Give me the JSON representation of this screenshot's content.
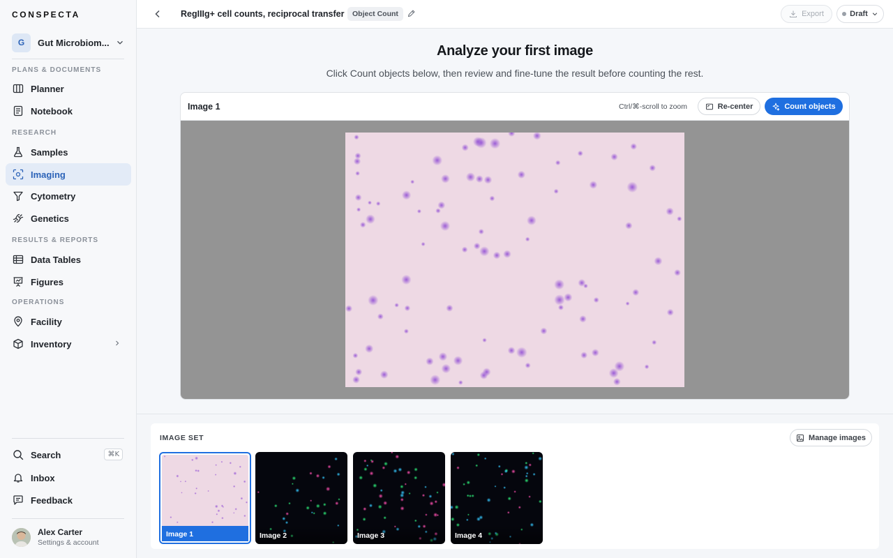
{
  "app": {
    "logo": "CONSPECTA"
  },
  "workspace": {
    "initial": "G",
    "name": "Gut Microbiom..."
  },
  "sidebar": {
    "sections": [
      {
        "label": "PLANS & DOCUMENTS",
        "items": [
          {
            "label": "Planner",
            "icon": "columns-icon"
          },
          {
            "label": "Notebook",
            "icon": "notebook-icon"
          }
        ]
      },
      {
        "label": "RESEARCH",
        "items": [
          {
            "label": "Samples",
            "icon": "flask-icon"
          },
          {
            "label": "Imaging",
            "icon": "imaging-icon",
            "active": true
          },
          {
            "label": "Cytometry",
            "icon": "funnel-icon"
          },
          {
            "label": "Genetics",
            "icon": "dna-icon"
          }
        ]
      },
      {
        "label": "RESULTS & REPORTS",
        "items": [
          {
            "label": "Data Tables",
            "icon": "table-icon"
          },
          {
            "label": "Figures",
            "icon": "chart-icon"
          }
        ]
      },
      {
        "label": "OPERATIONS",
        "items": [
          {
            "label": "Facility",
            "icon": "location-pin-icon"
          },
          {
            "label": "Inventory",
            "icon": "box-icon"
          }
        ]
      }
    ],
    "bottom": {
      "search": "Search",
      "search_shortcut": "⌘K",
      "inbox": "Inbox",
      "feedback": "Feedback"
    },
    "user": {
      "name": "Alex Carter",
      "subtitle": "Settings & account"
    }
  },
  "topbar": {
    "title": "RegIIIg+ cell counts, reciprocal transfer",
    "type_badge": "Object Count",
    "export_label": "Export",
    "status_label": "Draft"
  },
  "main": {
    "heading": "Analyze your first image",
    "subheading": "Click Count objects below, then review and fine-tune the result before counting the rest.",
    "viewer": {
      "title": "Image 1",
      "zoom_hint": "Ctrl/⌘-scroll to zoom",
      "recenter_label": "Re-center",
      "count_label": "Count objects"
    }
  },
  "image_set": {
    "label": "IMAGE SET",
    "manage_label": "Manage images",
    "images": [
      {
        "label": "Image 1",
        "selected": true,
        "style": "brightfield"
      },
      {
        "label": "Image 2",
        "selected": false,
        "style": "fluorescence"
      },
      {
        "label": "Image 3",
        "selected": false,
        "style": "fluorescence"
      },
      {
        "label": "Image 4",
        "selected": false,
        "style": "fluorescence"
      }
    ]
  },
  "colors": {
    "accent": "#1f6fe0",
    "active_nav_bg": "#e3ebf7",
    "stain_bg": "#eed9e4",
    "cell": "#9b5cd6"
  }
}
